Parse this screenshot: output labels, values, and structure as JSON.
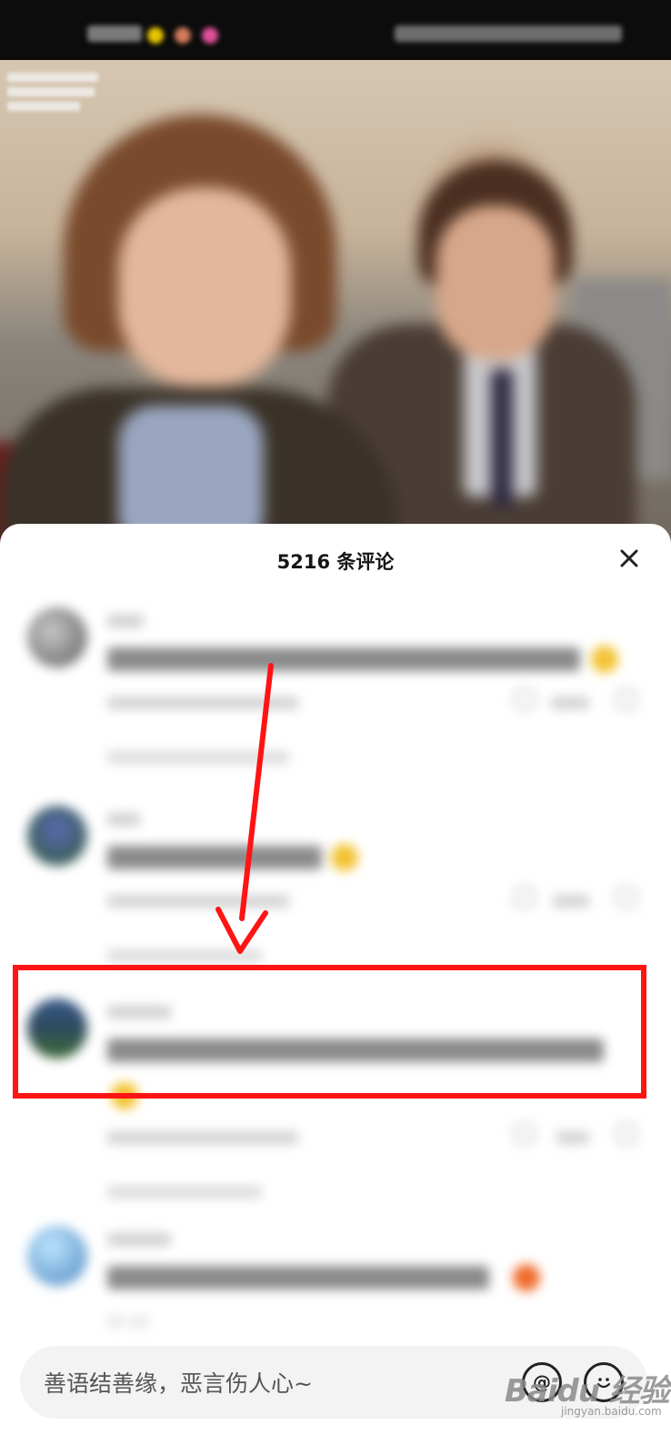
{
  "comments_header": {
    "title": "5216 条评论"
  },
  "comment_input": {
    "placeholder": "善语结善缘，恶言伤人心~"
  },
  "highlight_color": "#ff1414",
  "icons": [
    "close-icon",
    "at-icon",
    "emoji-icon",
    "like-icon",
    "dislike-icon"
  ],
  "watermark": {
    "text": "Baidu 经验",
    "sub": "jingyan.baidu.com"
  },
  "partial_visible": {
    "last_comment_date": "07-21"
  }
}
